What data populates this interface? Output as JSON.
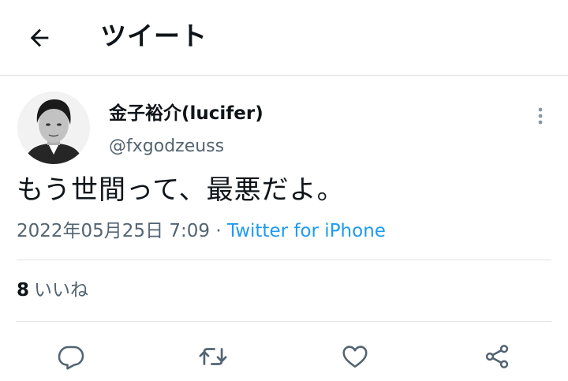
{
  "header": {
    "title": "ツイート",
    "back_icon": "arrow-left-icon"
  },
  "tweet": {
    "author": {
      "display_name": "金子裕介(lucifer)",
      "handle": "@fxgodzeuss",
      "avatar_icon": "avatar-photo"
    },
    "text": "もう世間って、最悪だよ。",
    "timestamp": "2022年05月25日 7:09",
    "separator": "·",
    "source": "Twitter for iPhone",
    "likes": {
      "count": "8",
      "label": "いいね"
    }
  },
  "actions": [
    {
      "name": "reply",
      "icon": "reply-icon"
    },
    {
      "name": "retweet",
      "icon": "retweet-icon"
    },
    {
      "name": "like",
      "icon": "heart-icon"
    },
    {
      "name": "share",
      "icon": "share-icon"
    }
  ],
  "colors": {
    "text": "#0f1419",
    "secondary": "#536471",
    "link": "#1d9bf0",
    "divider": "#e1e4e8"
  }
}
